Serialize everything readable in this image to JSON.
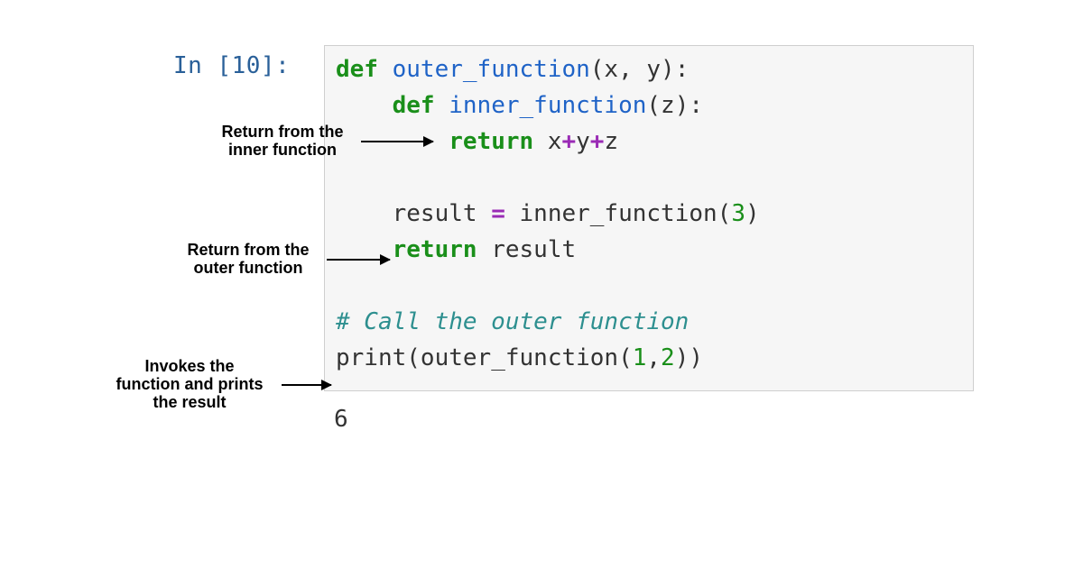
{
  "prompt": "In [10]:",
  "code": {
    "line1_def": "def",
    "line1_fn": " outer_function",
    "line1_rest": "(x, y):",
    "line2_indent": "    ",
    "line2_def": "def",
    "line2_fn": " inner_function",
    "line2_rest": "(z):",
    "line3_indent": "        ",
    "line3_kw": "return",
    "line3_sp": " x",
    "line3_op1": "+",
    "line3_y": "y",
    "line3_op2": "+",
    "line3_z": "z",
    "line4": "",
    "line5_indent": "    ",
    "line5_lhs": "result ",
    "line5_eq": "=",
    "line5_rhs": " inner_function(",
    "line5_num": "3",
    "line5_close": ")",
    "line6_indent": "    ",
    "line6_kw": "return",
    "line6_sp": " result",
    "line7": "",
    "line8_comment": "# Call the outer function",
    "line9_print": "print",
    "line9_open": "(outer_function(",
    "line9_n1": "1",
    "line9_comma": ",",
    "line9_n2": "2",
    "line9_close": "))"
  },
  "output": "6",
  "annotations": {
    "inner_return": "Return from the\ninner function",
    "outer_return": "Return from the\nouter function",
    "invoke": "Invokes the\nfunction and prints\nthe result"
  }
}
